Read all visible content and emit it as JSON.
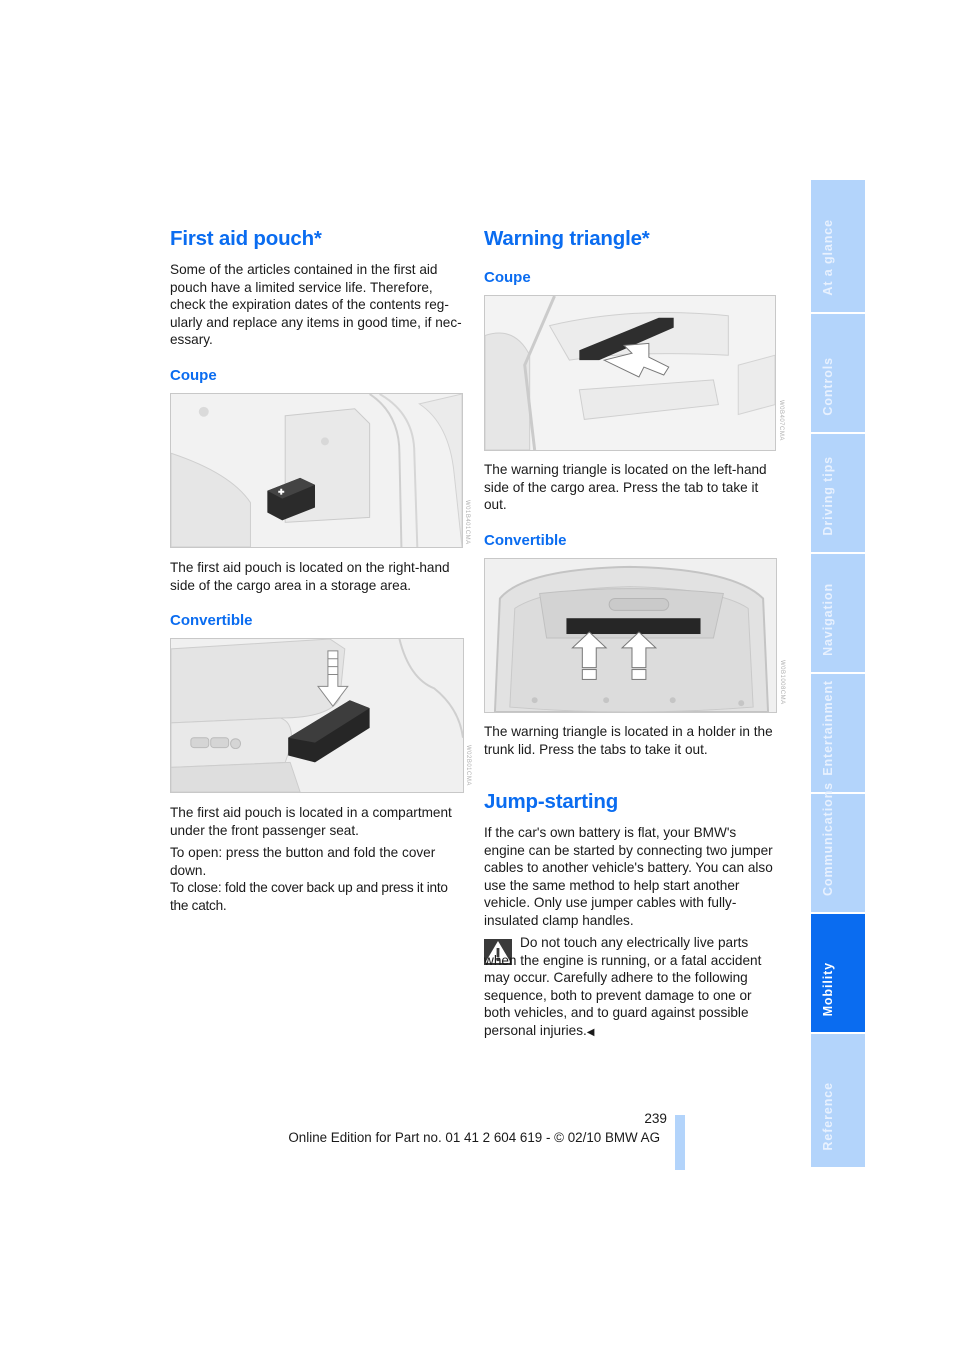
{
  "left_column": {
    "first_aid": {
      "title": "First aid pouch*",
      "intro": "Some of the articles contained in the first aid pouch have a limited service life. Therefore, check the expiration dates of the contents reg­ularly and replace any items in good time, if nec­essary.",
      "coupe": {
        "heading": "Coupe",
        "image_alt": "First aid pouch in cargo area storage compartment",
        "image_code": "W01B401CMA",
        "text": "The first aid pouch is located on the right-hand side of the cargo area in a storage area."
      },
      "convertible": {
        "heading": "Convertible",
        "image_alt": "First aid pouch compartment under front passenger seat",
        "image_code": "W02B01CMA",
        "text": "The first aid pouch is located in a compartment under the front passenger seat.",
        "open_text": "To open: press the button and fold the cover down.",
        "close_text": "To close: fold the cover back up and press it into the catch."
      }
    }
  },
  "right_column": {
    "warning_triangle": {
      "title": "Warning triangle*",
      "coupe": {
        "heading": "Coupe",
        "image_alt": "Warning triangle on left-hand side of cargo area",
        "image_code": "W0B407CMA",
        "text": "The warning triangle is located on the left-hand side of the cargo area. Press the tab to take it out."
      },
      "convertible": {
        "heading": "Convertible",
        "image_alt": "Warning triangle holder in trunk lid",
        "image_code": "W0B1008CMA",
        "text": "The warning triangle is located in a holder in the trunk lid. Press the tabs to take it out."
      }
    },
    "jump_starting": {
      "title": "Jump-starting",
      "intro": "If the car's own battery is flat, your BMW's engine can be started by connecting two jumper cables to another vehicle's battery. You can also use the same method to help start another vehicle. Only use jumper cables with fully-insulated clamp handles.",
      "warning": "Do not touch any electrically live parts when the engine is running, or a fatal acci­dent may occur. Carefully adhere to the follow­ing sequence, both to prevent damage to one or both vehicles, and to guard against possible personal injuries.",
      "end_mark": "◀"
    }
  },
  "side_tabs": [
    {
      "label": "At a glance",
      "active": false
    },
    {
      "label": "Controls",
      "active": false
    },
    {
      "label": "Driving tips",
      "active": false
    },
    {
      "label": "Navigation",
      "active": false
    },
    {
      "label": "Entertainment",
      "active": false
    },
    {
      "label": "Communications",
      "active": false
    },
    {
      "label": "Mobility",
      "active": true
    },
    {
      "label": "Reference",
      "active": false
    }
  ],
  "footer": {
    "page_number": "239",
    "edition": "Online Edition for Part no. 01 41 2 604 619 - © 02/10 BMW AG"
  },
  "colors": {
    "heading_blue": "#0a6cf0",
    "tab_light": "#b3d4fb",
    "tab_active": "#0a6cf0"
  }
}
